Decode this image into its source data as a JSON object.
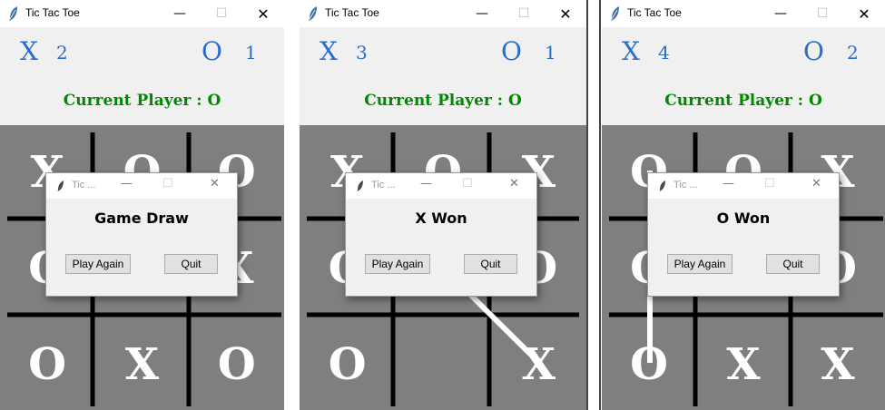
{
  "windows": [
    {
      "title": "Tic Tac Toe",
      "score": {
        "x_label": "X",
        "x_score": "2",
        "o_label": "O",
        "o_score": "1"
      },
      "current_player": "Current Player : O",
      "board": [
        "X",
        "O",
        "O",
        "O",
        "",
        "X",
        "O",
        "X",
        "O"
      ],
      "dialog": {
        "title": "Tic ...",
        "message": "Game Draw",
        "play_again": "Play Again",
        "quit": "Quit"
      }
    },
    {
      "title": "Tic Tac Toe",
      "score": {
        "x_label": "X",
        "x_score": "3",
        "o_label": "O",
        "o_score": "1"
      },
      "current_player": "Current Player : O",
      "board": [
        "X",
        "O",
        "X",
        "O",
        "",
        "O",
        "O",
        "",
        "X"
      ],
      "dialog": {
        "title": "Tic ...",
        "message": "X Won",
        "play_again": "Play Again",
        "quit": "Quit"
      }
    },
    {
      "title": "Tic Tac Toe",
      "score": {
        "x_label": "X",
        "x_score": "4",
        "o_label": "O",
        "o_score": "2"
      },
      "current_player": "Current Player : O",
      "board": [
        "O",
        "O",
        "X",
        "O",
        "",
        "O",
        "O",
        "X",
        "X"
      ],
      "dialog": {
        "title": "Tic ...",
        "message": "O Won",
        "play_again": "Play Again",
        "quit": "Quit"
      }
    }
  ],
  "icons": {
    "app": "feather-icon",
    "minimize": "minimize-icon",
    "maximize": "maximize-icon",
    "close": "close-icon"
  },
  "colors": {
    "score": "#2b6dc9",
    "current_player": "#008800",
    "board_bg": "#7f7f7f",
    "grid": "#000000",
    "marks": "#ffffff"
  }
}
